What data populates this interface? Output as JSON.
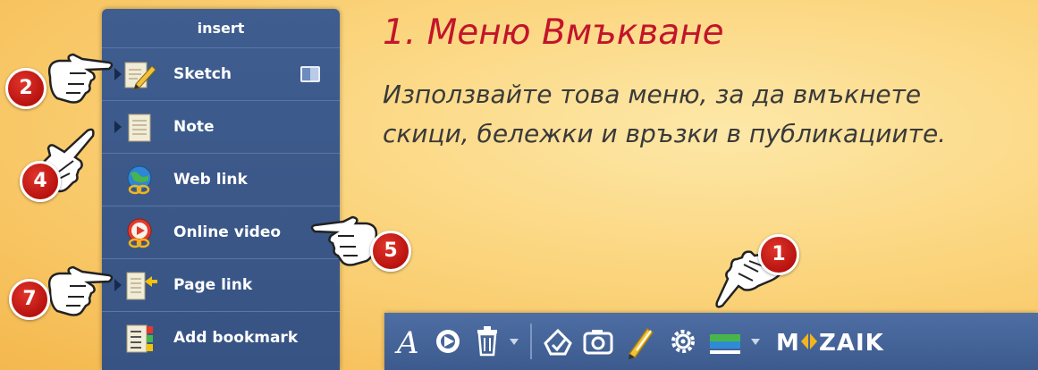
{
  "menu": {
    "header": "insert",
    "items": [
      {
        "label": "Sketch",
        "icon": "sketch-icon",
        "has_toggle": true
      },
      {
        "label": "Note",
        "icon": "note-icon"
      },
      {
        "label": "Web link",
        "icon": "web-link-icon"
      },
      {
        "label": "Online video",
        "icon": "online-video-icon"
      },
      {
        "label": "Page link",
        "icon": "page-link-icon"
      },
      {
        "label": "Add bookmark",
        "icon": "add-bookmark-icon"
      }
    ]
  },
  "heading": {
    "title": "1. Меню Вмъкване",
    "description_line1": "Използвайте това меню, за да вмъкнете",
    "description_line2": "скици, бележки и връзки в публикациите."
  },
  "badges": {
    "b1": "1",
    "b2": "2",
    "b4": "4",
    "b5": "5",
    "b7": "7"
  },
  "toolbar": {
    "tools": [
      "text-tool-icon",
      "pointer-tool-icon",
      "trash-icon",
      "dropdown-arrow-icon",
      "insert-tool-icon",
      "camera-icon",
      "pencil-icon",
      "settings-icon",
      "ruler-icon",
      "dropdown-arrow-icon"
    ],
    "logo": "MOZAIK"
  },
  "colors": {
    "menu_bg": "#3f5d8f",
    "title_red": "#c2152b",
    "badge_red": "#c41b17",
    "toolbar_bg": "#45659b",
    "logo_arrow": "#f2b51c"
  }
}
